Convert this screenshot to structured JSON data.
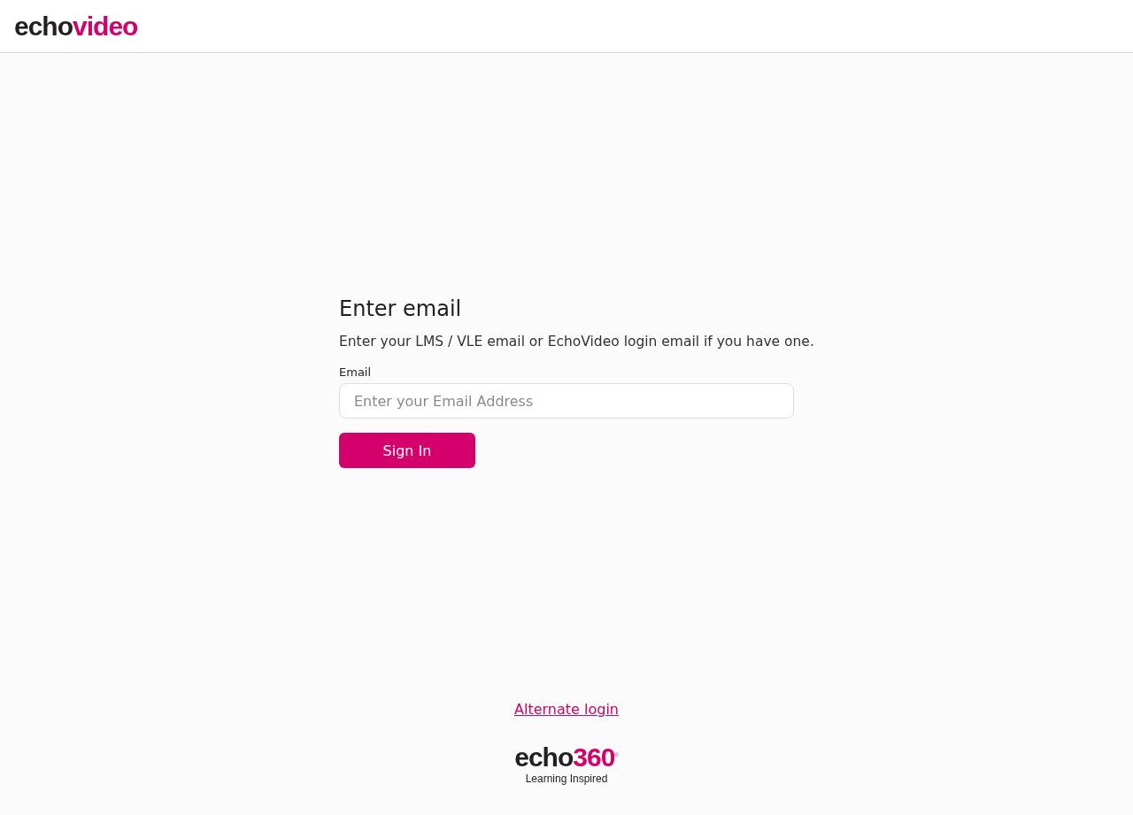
{
  "header": {
    "logo": {
      "dark": "echo",
      "accent": "video"
    }
  },
  "form": {
    "title": "Enter email",
    "description": "Enter your LMS / VLE email or EchoVideo login email if you have one.",
    "email_label": "Email",
    "email_placeholder": "Enter your Email Address",
    "submit": "Sign In"
  },
  "footer": {
    "link": "Alternate login",
    "logo": {
      "dark": "echo",
      "accent": "360",
      "mark": "®"
    },
    "tagline": "Learning Inspired"
  }
}
